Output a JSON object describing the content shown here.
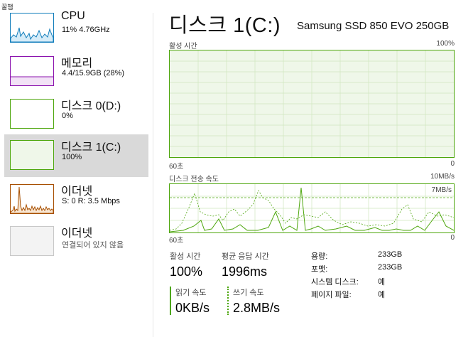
{
  "top_caption": "꿀챔",
  "sidebar": {
    "items": [
      {
        "title": "CPU",
        "sub": "11% 4.76GHz"
      },
      {
        "title": "메모리",
        "sub": "4.4/15.9GB (28%)"
      },
      {
        "title": "디스크 0(D:)",
        "sub": "0%"
      },
      {
        "title": "디스크 1(C:)",
        "sub": "100%"
      },
      {
        "title": "이더넷",
        "sub": "S: 0 R: 3.5 Mbps"
      },
      {
        "title": "이더넷",
        "sub": "연결되어 있지 않음"
      }
    ]
  },
  "main": {
    "title": "디스크 1(C:)",
    "model": "Samsung SSD 850 EVO 250GB",
    "activity_chart": {
      "label": "활성 시간",
      "max_label": "100%",
      "x_left": "60초",
      "x_right": "0",
      "value": 100
    },
    "transfer_chart": {
      "label": "디스크 전송 속도",
      "max_label": "10MB/s",
      "inner_label": "7MB/s",
      "x_left": "60초",
      "x_right": "0"
    },
    "stats": {
      "active_time_label": "활성 시간",
      "active_time_value": "100%",
      "avg_response_label": "평균 응답 시간",
      "avg_response_value": "1996ms",
      "read_label": "읽기 속도",
      "read_value": "0KB/s",
      "write_label": "쓰기 속도",
      "write_value": "2.8MB/s"
    },
    "properties": [
      {
        "key": "용량:",
        "value": "233GB"
      },
      {
        "key": "포맷:",
        "value": "233GB"
      },
      {
        "key": "시스템 디스크:",
        "value": "예"
      },
      {
        "key": "페이지 파일:",
        "value": "예"
      }
    ]
  },
  "colors": {
    "cpu": "#117dbb",
    "memory": "#8b12ae",
    "disk": "#4da60c",
    "ethernet": "#a74f01",
    "selected_bg": "#d9d9d9"
  }
}
